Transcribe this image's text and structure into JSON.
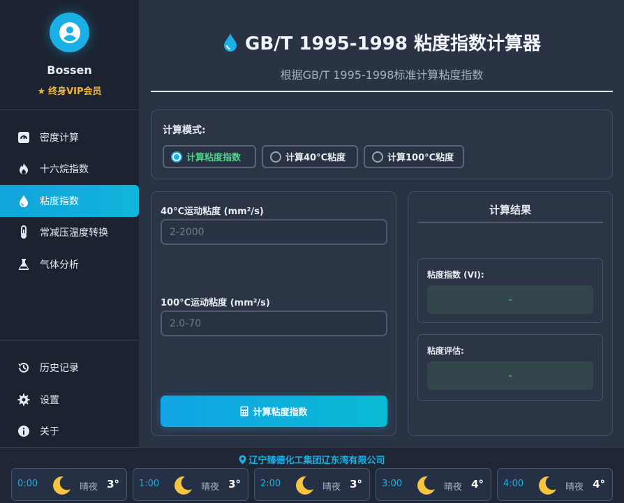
{
  "user": {
    "name": "Bossen",
    "badge": "终身VIP会员"
  },
  "nav": {
    "items": [
      {
        "label": "密度计算",
        "icon": "gauge-icon"
      },
      {
        "label": "十六烷指数",
        "icon": "fire-icon"
      },
      {
        "label": "粘度指数",
        "icon": "droplet-icon"
      },
      {
        "label": "常减压温度转换",
        "icon": "thermometer-icon"
      },
      {
        "label": "气体分析",
        "icon": "flask-icon"
      }
    ],
    "active": "粘度指数",
    "bottom": [
      {
        "label": "历史记录",
        "icon": "history-icon"
      },
      {
        "label": "设置",
        "icon": "gear-icon"
      },
      {
        "label": "关于",
        "icon": "info-icon"
      }
    ]
  },
  "header": {
    "title": "GB/T 1995-1998 粘度指数计算器",
    "subtitle": "根据GB/T 1995-1998标准计算粘度指数"
  },
  "mode": {
    "label": "计算模式:",
    "options": [
      "计算粘度指数",
      "计算40°C粘度",
      "计算100°C粘度"
    ],
    "selected": "计算粘度指数"
  },
  "inputs": {
    "v40": {
      "label": "40°C运动粘度 (mm²/s)",
      "placeholder": "2-2000",
      "value": ""
    },
    "v100": {
      "label": "100°C运动粘度 (mm²/s)",
      "placeholder": "2.0-70",
      "value": ""
    },
    "button": "计算粘度指数"
  },
  "results": {
    "title": "计算结果",
    "vi_label": "粘度指数 (VI):",
    "vi_value": "-",
    "eval_label": "粘度评估:",
    "eval_value": "-"
  },
  "footer": {
    "company": "辽宁臻德化工集团辽东湾有限公司",
    "hourly": [
      {
        "time": "0:00",
        "weather": "晴夜",
        "temp": "3°"
      },
      {
        "time": "1:00",
        "weather": "晴夜",
        "temp": "3°"
      },
      {
        "time": "2:00",
        "weather": "晴夜",
        "temp": "3°"
      },
      {
        "time": "3:00",
        "weather": "晴夜",
        "temp": "4°"
      },
      {
        "time": "4:00",
        "weather": "晴夜",
        "temp": "4°"
      }
    ]
  },
  "colors": {
    "accent": "#1ab0e6",
    "success": "#4fd18b",
    "vip": "#f5b82e",
    "background": "#2a3344",
    "sidebar": "#1c2230"
  }
}
